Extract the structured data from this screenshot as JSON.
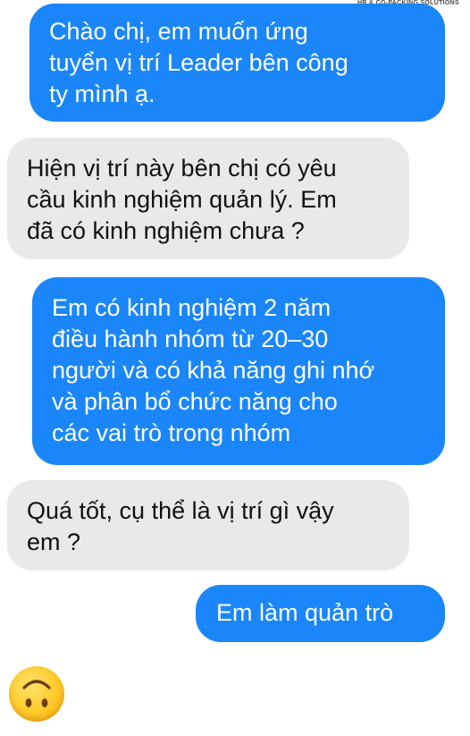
{
  "watermark": "HR & CO-PACKING SOLUTIONS",
  "colors": {
    "sent_bubble": "#1a86fa",
    "received_bubble": "#e9e9eb",
    "sent_text": "#ffffff",
    "received_text": "#111111"
  },
  "messages": [
    {
      "sender": "me",
      "lines": [
        "Chào chị, em muốn ứng",
        "tuyển vị trí Leader bên công",
        "ty mình ạ."
      ]
    },
    {
      "sender": "other",
      "lines": [
        "Hiện vị trí này bên chị có yêu",
        "cầu kinh nghiệm quản lý. Em",
        "đã có kinh nghiệm chưa ?"
      ]
    },
    {
      "sender": "me",
      "lines": [
        "Em có kinh nghiệm 2 năm",
        "điều hành nhóm từ 20–30",
        "người và có khả năng ghi nhớ",
        "và phân bổ chức năng cho",
        "các vai trò trong nhóm"
      ]
    },
    {
      "sender": "other",
      "lines": [
        "Quá tốt, cụ thể là vị trí gì vậy",
        "em ?"
      ]
    },
    {
      "sender": "me",
      "lines": [
        "Em làm quản trò"
      ]
    }
  ],
  "reaction_emoji": "upside-down-face-icon"
}
